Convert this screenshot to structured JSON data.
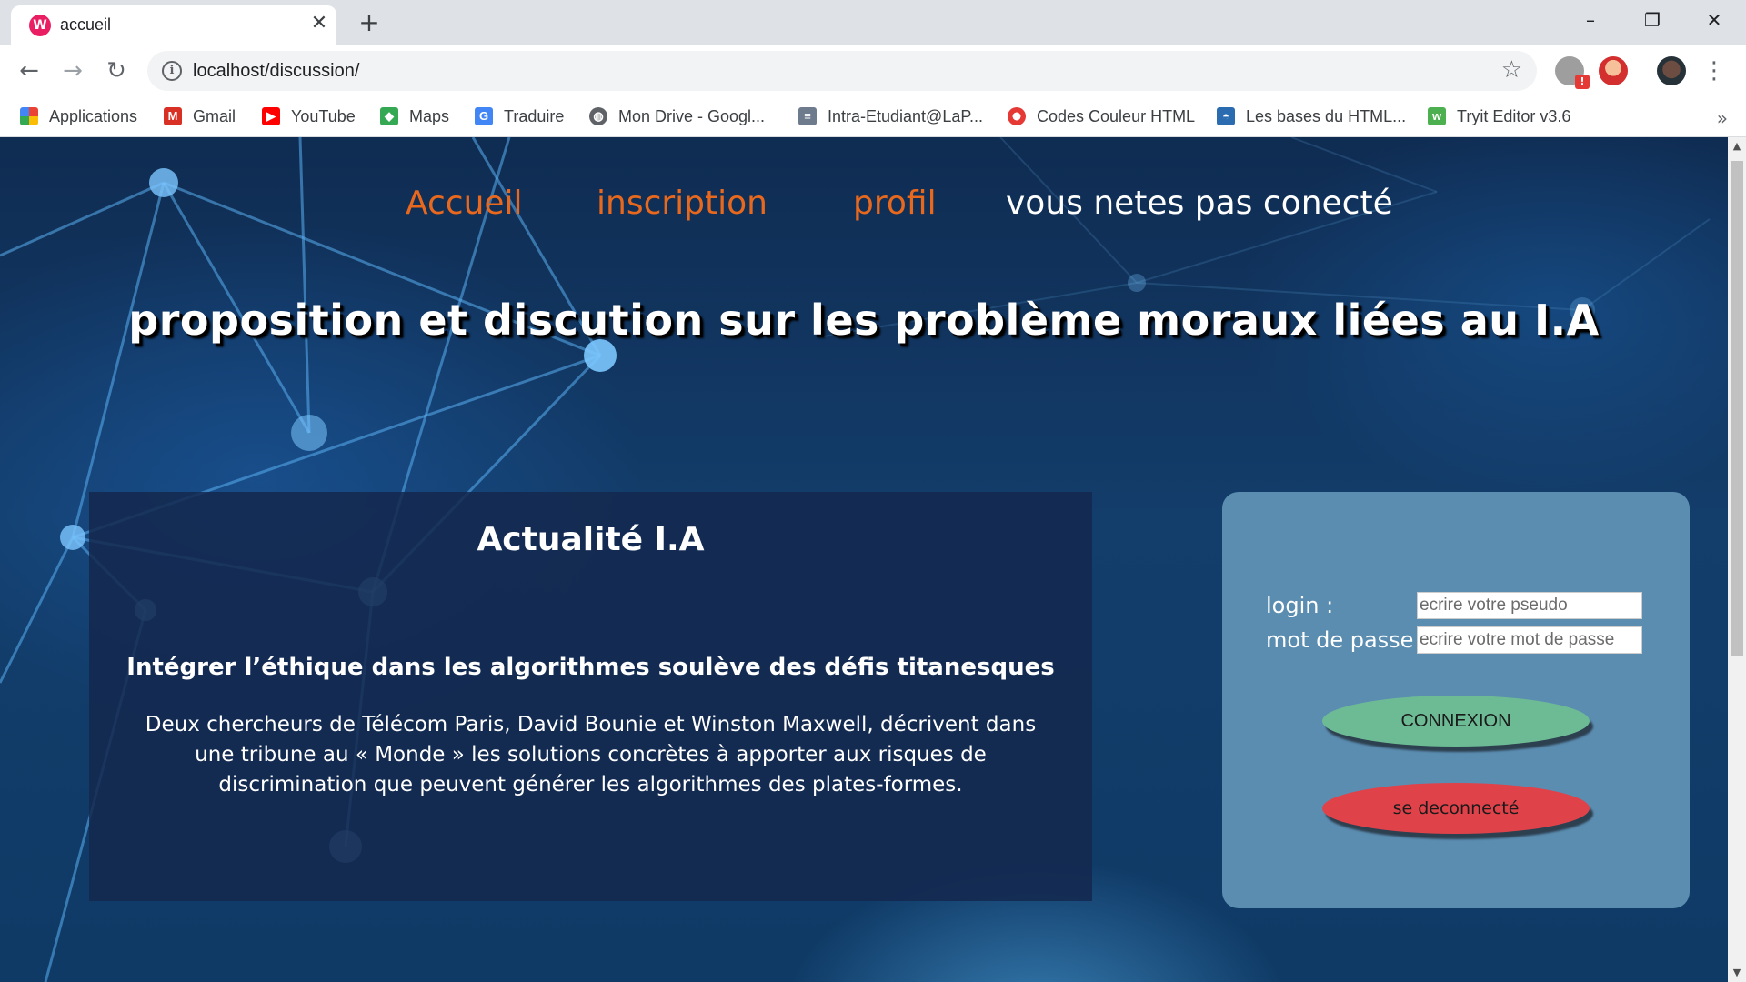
{
  "browser": {
    "tab": {
      "title": "accueil",
      "favicon": "wamp-icon",
      "close_glyph": "✕"
    },
    "new_tab_glyph": "+",
    "window_controls": {
      "minimize": "–",
      "restore": "❐",
      "close": "✕"
    },
    "nav": {
      "back": "←",
      "forward": "→",
      "reload": "↻"
    },
    "address": {
      "url": "localhost/discussion/",
      "info_glyph": "i",
      "star_glyph": "☆"
    },
    "extensions": [
      {
        "name": "adblock-extension-icon",
        "badge": "!"
      },
      {
        "name": "santa-extension-icon"
      },
      {
        "name": "profile-avatar"
      }
    ],
    "menu_glyph": "⋮",
    "bookmarks": [
      {
        "label": "Applications",
        "icon": "apps-grid-icon",
        "color": "#4285f4"
      },
      {
        "label": "Gmail",
        "icon": "gmail-icon",
        "color": "#d93025"
      },
      {
        "label": "YouTube",
        "icon": "youtube-icon",
        "color": "#ff0000"
      },
      {
        "label": "Maps",
        "icon": "maps-icon",
        "color": "#34a853"
      },
      {
        "label": "Traduire",
        "icon": "translate-icon",
        "color": "#4285f4"
      },
      {
        "label": "Mon Drive - Googl...",
        "icon": "globe-icon",
        "color": "#5f6368"
      },
      {
        "label": "Intra-Etudiant@LaP...",
        "icon": "intra-icon",
        "color": "#6d7b8d"
      },
      {
        "label": "Codes Couleur HTML",
        "icon": "color-wheel-icon",
        "color": "#e53935"
      },
      {
        "label": "Les bases du HTML...",
        "icon": "openclassrooms-icon",
        "color": "#2b6cb0"
      },
      {
        "label": "Tryit Editor v3.6",
        "icon": "w3schools-icon",
        "color": "#4caf50"
      }
    ],
    "bookmarks_more": "»"
  },
  "page": {
    "nav": {
      "home": "Accueil",
      "signup": "inscription",
      "profile": "profil",
      "status": "vous netes pas conecté"
    },
    "hero_title": "proposition et discution sur les problème moraux liées au I.A",
    "news": {
      "title": "Actualité I.A",
      "headline": "Intégrer l’éthique dans les algorithmes soulève des défis titanesques",
      "body": "Deux chercheurs de Télécom Paris, David Bounie et Winston Maxwell, décrivent dans une tribune au « Monde » les solutions concrètes à apporter aux risques de discrimination que peuvent générer les algorithmes des plates-formes."
    },
    "login_form": {
      "login_label": "login :",
      "login_placeholder": "ecrire votre pseudo",
      "password_label": "mot de passe :",
      "password_placeholder": "ecrire votre mot de passe",
      "connect_button": "CONNEXION",
      "logout_button": "se deconnecté"
    },
    "colors": {
      "nav_link": "#e8691e",
      "connect_button": "#6dbb94",
      "logout_button": "#e0424a",
      "login_panel": "#5b8db1",
      "news_panel": "#14284e"
    }
  }
}
